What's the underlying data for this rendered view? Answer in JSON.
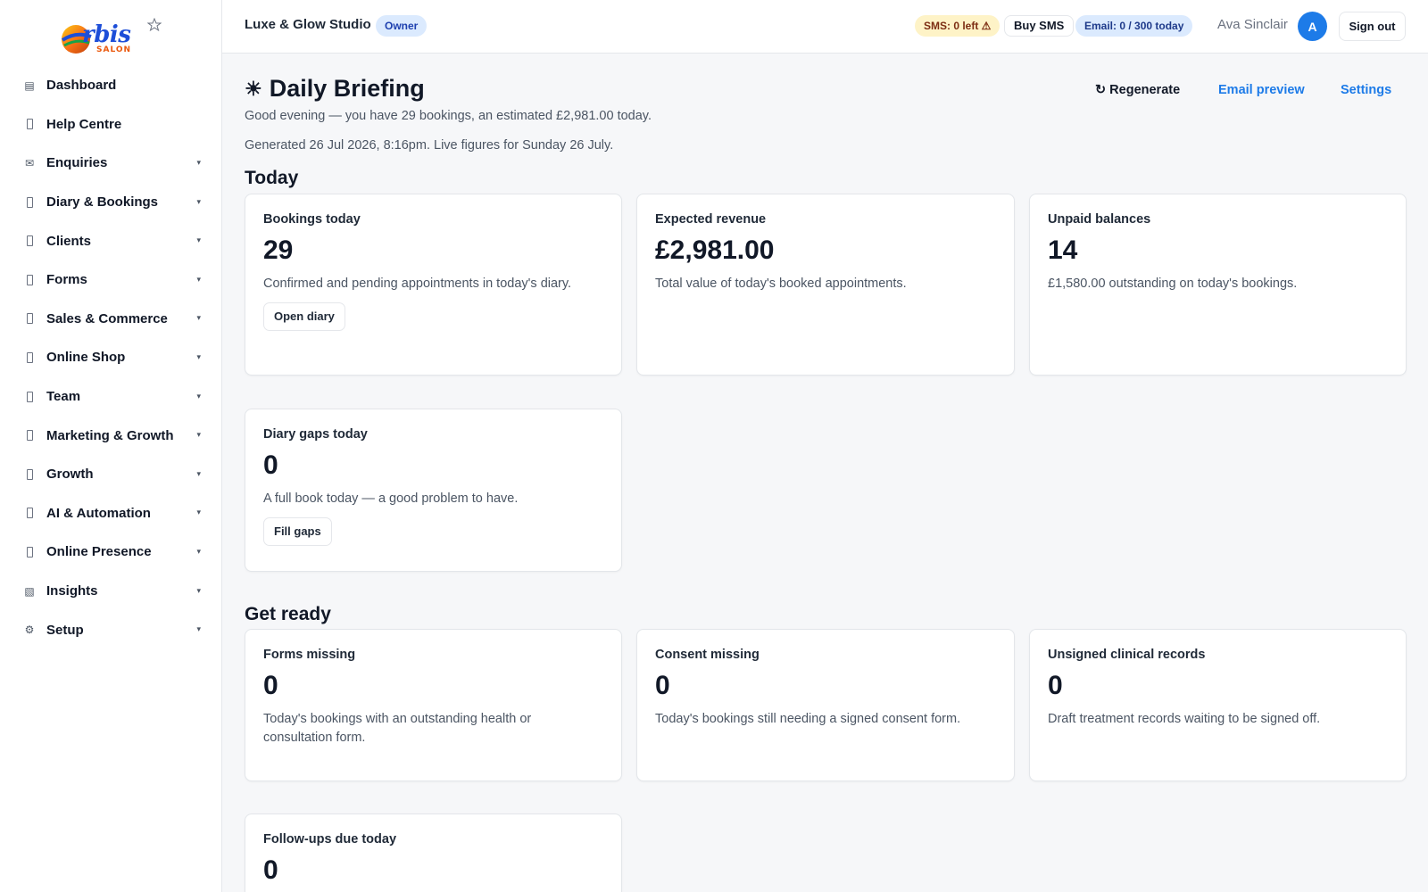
{
  "brand": {
    "name": "rbis",
    "sub": "SALON"
  },
  "sidebar": {
    "items": [
      {
        "label": "Dashboard",
        "icon": "dashboard-icon",
        "glyph": "▤",
        "chevron": false
      },
      {
        "label": "Help Centre",
        "icon": "help-icon",
        "glyph": "",
        "chevron": false
      },
      {
        "label": "Enquiries",
        "icon": "mail-icon",
        "glyph": "✉",
        "chevron": true
      },
      {
        "label": "Diary & Bookings",
        "icon": "calendar-icon",
        "glyph": "",
        "chevron": true
      },
      {
        "label": "Clients",
        "icon": "clients-icon",
        "glyph": "",
        "chevron": true
      },
      {
        "label": "Forms",
        "icon": "forms-icon",
        "glyph": "",
        "chevron": true
      },
      {
        "label": "Sales & Commerce",
        "icon": "sales-icon",
        "glyph": "",
        "chevron": true
      },
      {
        "label": "Online Shop",
        "icon": "shop-icon",
        "glyph": "",
        "chevron": true
      },
      {
        "label": "Team",
        "icon": "team-icon",
        "glyph": "",
        "chevron": true
      },
      {
        "label": "Marketing & Growth",
        "icon": "marketing-icon",
        "glyph": "",
        "chevron": true
      },
      {
        "label": "Growth",
        "icon": "growth-icon",
        "glyph": "",
        "chevron": true
      },
      {
        "label": "AI & Automation",
        "icon": "ai-icon",
        "glyph": "",
        "chevron": true
      },
      {
        "label": "Online Presence",
        "icon": "web-icon",
        "glyph": "",
        "chevron": true
      },
      {
        "label": "Insights",
        "icon": "insights-icon",
        "glyph": "▧",
        "chevron": true
      },
      {
        "label": "Setup",
        "icon": "gear-icon",
        "glyph": "⚙",
        "chevron": true
      }
    ],
    "chevron_glyph": "▾"
  },
  "header": {
    "studio": "Luxe & Glow Studio",
    "role": "Owner",
    "sms": "SMS: 0 left ⚠",
    "buy_sms": "Buy SMS",
    "email": "Email: 0 / 300 today",
    "user": "Ava Sinclair",
    "avatar_initial": "A",
    "sign_out": "Sign out"
  },
  "page": {
    "title_icon": "☀",
    "title": "Daily Briefing",
    "greeting": "Good evening — you have 29 bookings, an estimated £2,981.00 today.",
    "generated": "Generated 26 Jul 2026, 8:16pm. Live figures for Sunday 26 July.",
    "actions": {
      "regenerate": "↻ Regenerate",
      "email_preview": "Email preview",
      "settings": "Settings"
    }
  },
  "sections": {
    "today": {
      "title": "Today",
      "cards": [
        {
          "title": "Bookings today",
          "value": "29",
          "desc": "Confirmed and pending appointments in today's diary.",
          "button": "Open diary"
        },
        {
          "title": "Expected revenue",
          "value": "£2,981.00",
          "desc": "Total value of today's booked appointments.",
          "button": ""
        },
        {
          "title": "Unpaid balances",
          "value": "14",
          "desc": "£1,580.00 outstanding on today's bookings.",
          "button": ""
        },
        {
          "title": "Diary gaps today",
          "value": "0",
          "desc": "A full book today — a good problem to have.",
          "button": "Fill gaps"
        }
      ]
    },
    "get_ready": {
      "title": "Get ready",
      "cards": [
        {
          "title": "Forms missing",
          "value": "0",
          "desc": "Today's bookings with an outstanding health or consultation form."
        },
        {
          "title": "Consent missing",
          "value": "0",
          "desc": "Today's bookings still needing a signed consent form."
        },
        {
          "title": "Unsigned clinical records",
          "value": "0",
          "desc": "Draft treatment records waiting to be signed off."
        },
        {
          "title": "Follow-ups due today",
          "value": "0",
          "desc": ""
        }
      ]
    }
  },
  "colors": {
    "accent": "#1d7be8",
    "sms_bg": "#fef3c7",
    "email_bg": "#dbeafe"
  }
}
